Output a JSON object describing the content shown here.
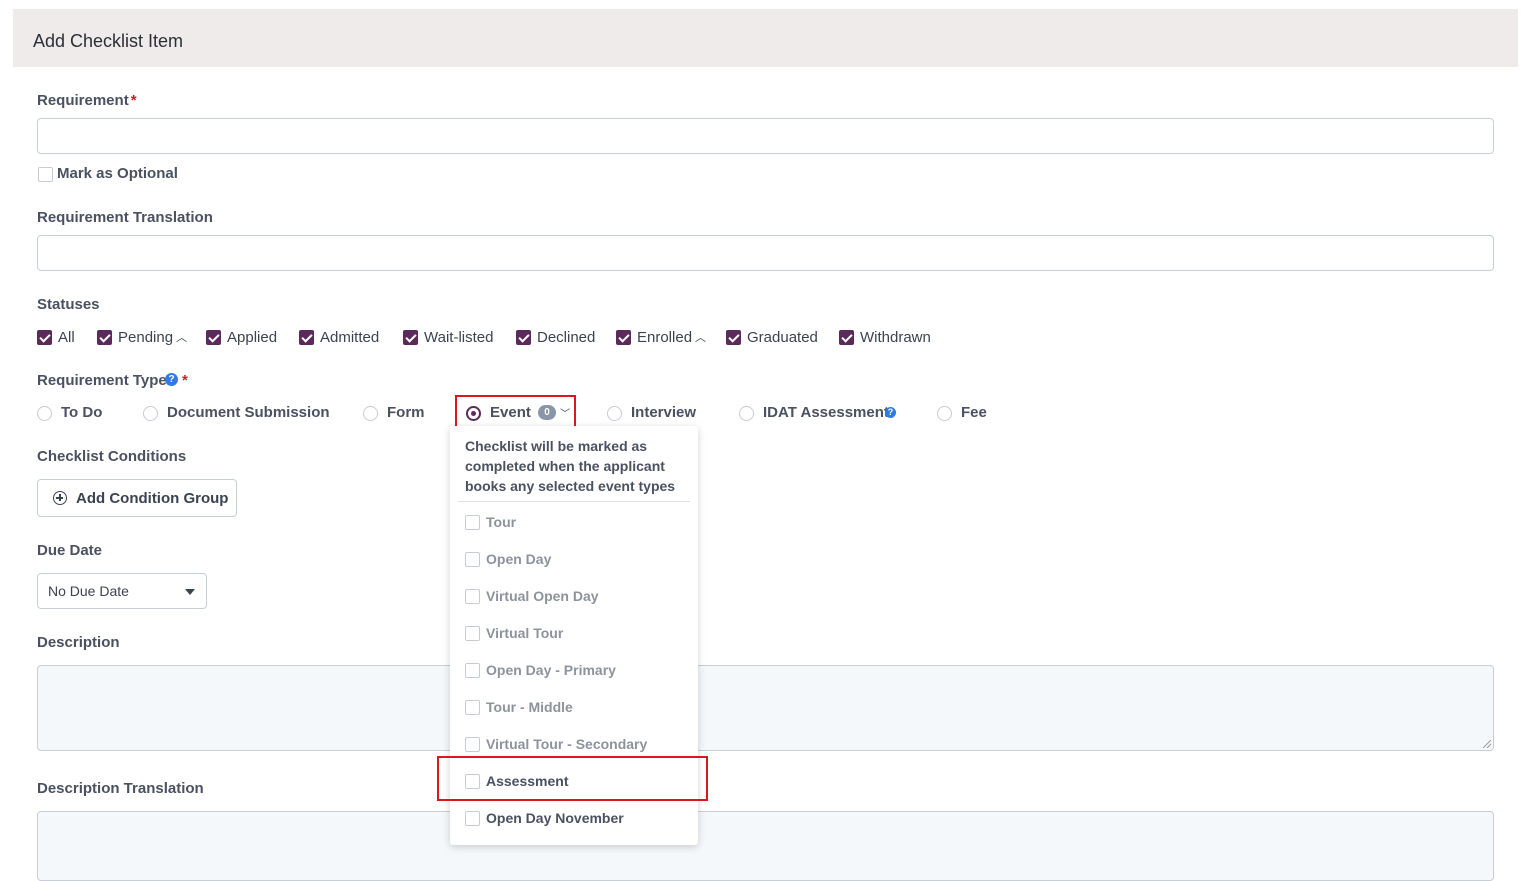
{
  "header": {
    "title": "Add Checklist Item"
  },
  "requirement": {
    "label": "Requirement",
    "required_mark": "*",
    "value": ""
  },
  "optional": {
    "label": "Mark as Optional",
    "checked": false
  },
  "translation": {
    "label": "Requirement Translation",
    "value": ""
  },
  "statuses": {
    "label": "Statuses",
    "items": [
      {
        "label": "All",
        "checked": true,
        "expandable": false
      },
      {
        "label": "Pending",
        "checked": true,
        "expandable": true
      },
      {
        "label": "Applied",
        "checked": true,
        "expandable": false
      },
      {
        "label": "Admitted",
        "checked": true,
        "expandable": false
      },
      {
        "label": "Wait-listed",
        "checked": true,
        "expandable": false
      },
      {
        "label": "Declined",
        "checked": true,
        "expandable": false
      },
      {
        "label": "Enrolled",
        "checked": true,
        "expandable": true
      },
      {
        "label": "Graduated",
        "checked": true,
        "expandable": false
      },
      {
        "label": "Withdrawn",
        "checked": true,
        "expandable": false
      }
    ],
    "chevron_icon": "chevron-up-icon"
  },
  "requirement_type": {
    "label": "Requirement Type",
    "help_icon": "question-circle-icon",
    "help_glyph": "?",
    "required_mark": "*",
    "options": [
      {
        "label": "To Do",
        "selected": false
      },
      {
        "label": "Document Submission",
        "selected": false
      },
      {
        "label": "Form",
        "selected": false
      },
      {
        "label": "Event",
        "selected": true,
        "badge": "0"
      },
      {
        "label": "Interview",
        "selected": false
      },
      {
        "label": "IDAT Assessment",
        "selected": false
      },
      {
        "label": "Fee",
        "selected": false
      }
    ]
  },
  "conditions": {
    "label": "Checklist Conditions",
    "button_label": "Add Condition Group"
  },
  "due_date": {
    "label": "Due Date",
    "value": "No Due Date"
  },
  "description": {
    "label": "Description",
    "value": ""
  },
  "description_translation": {
    "label": "Description Translation",
    "value": ""
  },
  "event_dropdown": {
    "description": "Checklist will be marked as completed when the applicant books any selected event types",
    "items": [
      {
        "label": "Tour",
        "checked": false
      },
      {
        "label": "Open Day",
        "checked": false
      },
      {
        "label": "Virtual Open Day",
        "checked": false
      },
      {
        "label": "Virtual Tour",
        "checked": false
      },
      {
        "label": "Open Day - Primary",
        "checked": false
      },
      {
        "label": "Tour - Middle",
        "checked": false
      },
      {
        "label": "Virtual Tour - Secondary",
        "checked": false
      },
      {
        "label": "Assessment",
        "checked": false
      },
      {
        "label": "Open Day November",
        "checked": false
      }
    ]
  },
  "colors": {
    "accent": "#5a2a5a",
    "highlight": "#d7191f",
    "header_bg": "#efebeb",
    "help": "#2f7de1"
  }
}
